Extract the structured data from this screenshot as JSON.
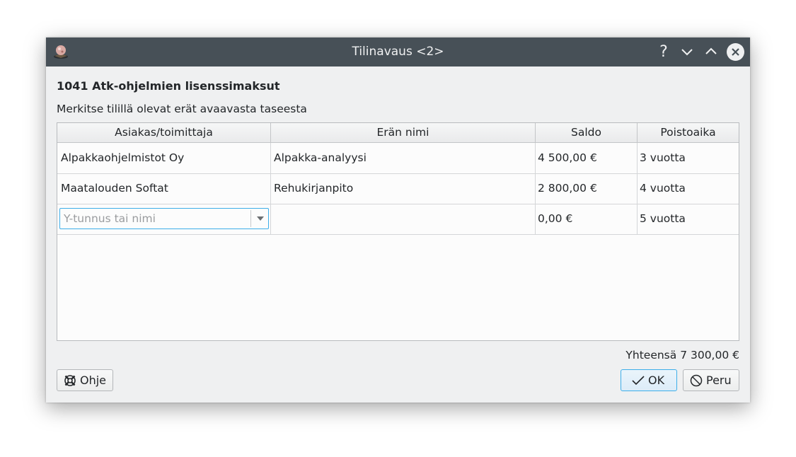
{
  "window": {
    "title": "Tilinavaus <2>",
    "help_glyph": "?"
  },
  "heading": "1041 Atk-ohjelmien lisenssimaksut",
  "subheading": "Merkitse tilillä olevat erät avaavasta taseesta",
  "table": {
    "columns": [
      "Asiakas/toimittaja",
      "Erän nimi",
      "Saldo",
      "Poistoaika"
    ],
    "rows": [
      {
        "party": "Alpakkaohjelmistot Oy",
        "name": "Alpakka-analyysi",
        "balance": "4 500,00 €",
        "period": "3 vuotta"
      },
      {
        "party": "Maatalouden Softat",
        "name": "Rehukirjanpito",
        "balance": "2 800,00 €",
        "period": "4 vuotta"
      }
    ],
    "new_row": {
      "party_placeholder": "Y-tunnus tai nimi",
      "name": "",
      "balance": "0,00 €",
      "period": "5 vuotta"
    }
  },
  "total": "Yhteensä 7 300,00 €",
  "buttons": {
    "help": "Ohje",
    "ok": "OK",
    "cancel": "Peru"
  },
  "icons": {
    "app": "app-logo-icon",
    "help": "help-icon",
    "minimize": "chevron-down-icon",
    "maximize": "chevron-up-icon",
    "close": "close-icon",
    "lifebuoy": "lifebuoy-icon",
    "ok": "checkmark-icon",
    "cancel": "cancel-icon"
  },
  "colors": {
    "titlebar": "#475057",
    "accent": "#3daee9",
    "window_bg": "#eff0f1"
  }
}
